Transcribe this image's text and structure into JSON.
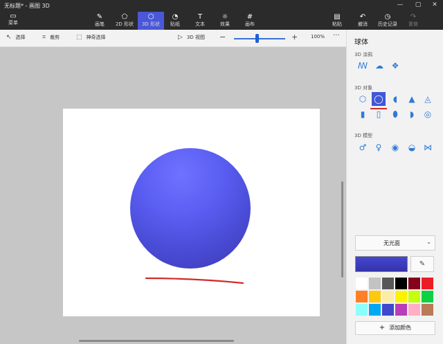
{
  "window": {
    "title": "无标题* - 画图 3D",
    "controls": [
      "—",
      "▢",
      "✕"
    ]
  },
  "menu": {
    "icon": "folder-icon",
    "label": "菜单"
  },
  "ribbon": {
    "tools": [
      {
        "label": "画笔",
        "icon": "brush-icon",
        "glyph": "✎"
      },
      {
        "label": "2D 形状",
        "icon": "2d-shapes-icon",
        "glyph": "⬠"
      },
      {
        "label": "3D 形状",
        "icon": "3d-shapes-icon",
        "glyph": "⬡"
      },
      {
        "label": "贴纸",
        "icon": "sticker-icon",
        "glyph": "◔"
      },
      {
        "label": "文本",
        "icon": "text-icon",
        "glyph": "T"
      },
      {
        "label": "效果",
        "icon": "effects-icon",
        "glyph": "☼"
      },
      {
        "label": "画布",
        "icon": "canvas-icon",
        "glyph": "#"
      }
    ],
    "active_tool": "3D 形状",
    "right_tools": [
      {
        "label": "粘贴",
        "icon": "paste-icon",
        "glyph": "▤"
      },
      {
        "label": "撤消",
        "icon": "undo-icon",
        "glyph": "↶"
      },
      {
        "label": "历史记录",
        "icon": "history-icon",
        "glyph": "◷"
      },
      {
        "label": "重做",
        "icon": "redo-icon",
        "glyph": "↷"
      }
    ]
  },
  "toolbar": {
    "select_label": "选择",
    "crop_label": "裁剪",
    "magic_select_label": "神奇选择",
    "view3d_label": "3D 视图",
    "zoom_value": "100%",
    "zoom_level": 0.45,
    "more": "···"
  },
  "panel": {
    "title": "球体",
    "doodle_label": "3D 涂鸦",
    "objects_label": "3D 对象",
    "models_label": "3D 模型",
    "material": "无光面",
    "add_color_label": "添加颜色",
    "selected_color": "#3f42c4",
    "swatches": [
      "#ffffff",
      "#c3c3c3",
      "#585858",
      "#000000",
      "#88001b",
      "#ec1c24",
      "#ff7f27",
      "#ffc90e",
      "#fdeca6",
      "#fff200",
      "#c4ff0e",
      "#0ed145",
      "#8cfffb",
      "#00a8f3",
      "#3f48cc",
      "#b83dba",
      "#ffaec8",
      "#b97a56"
    ]
  }
}
